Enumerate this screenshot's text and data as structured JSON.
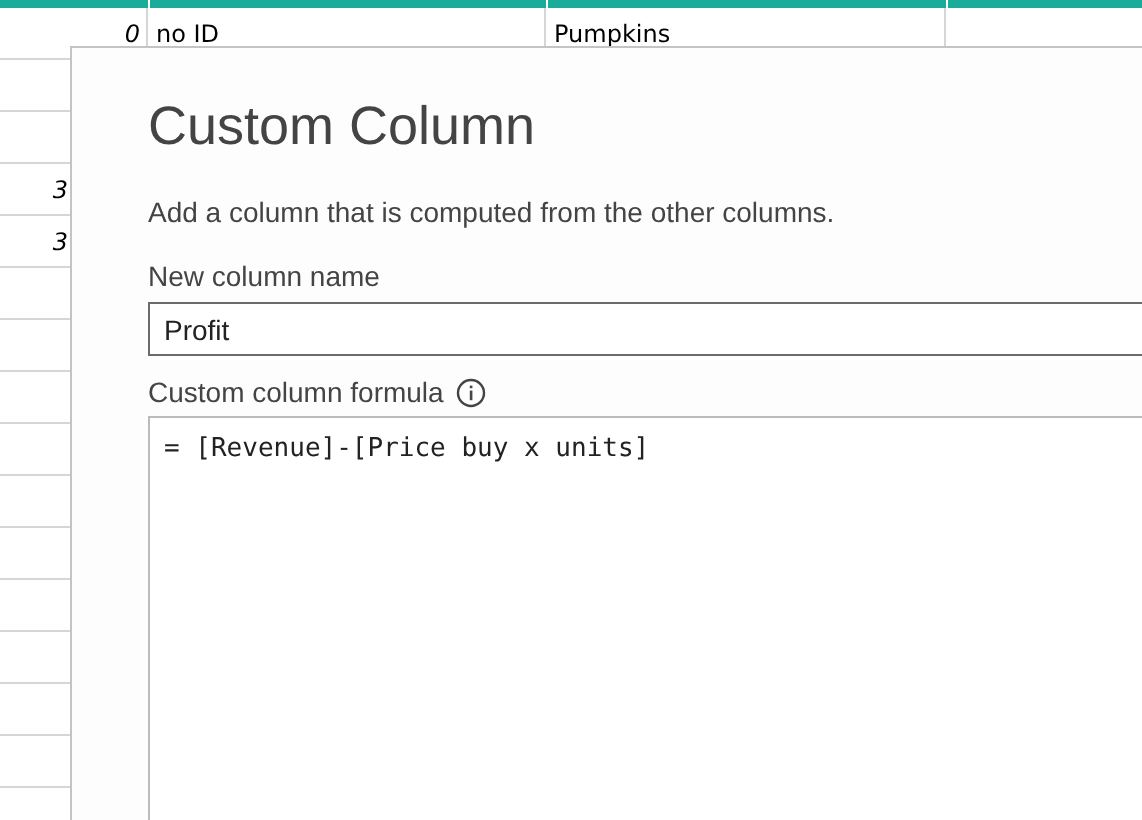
{
  "grid": {
    "rows": [
      {
        "number": "0",
        "id": "no ID",
        "name": "Pumpkins"
      },
      {},
      {},
      {
        "number_cut": "3"
      },
      {
        "number_cut": "3"
      },
      {},
      {},
      {},
      {},
      {},
      {},
      {},
      {},
      {},
      {},
      {}
    ]
  },
  "dialog": {
    "title": "Custom Column",
    "description": "Add a column that is computed from the other columns.",
    "name_label": "New column name",
    "name_value": "Profit",
    "formula_label": "Custom column formula",
    "formula_value": "= [Revenue]-[Price buy x units]"
  }
}
